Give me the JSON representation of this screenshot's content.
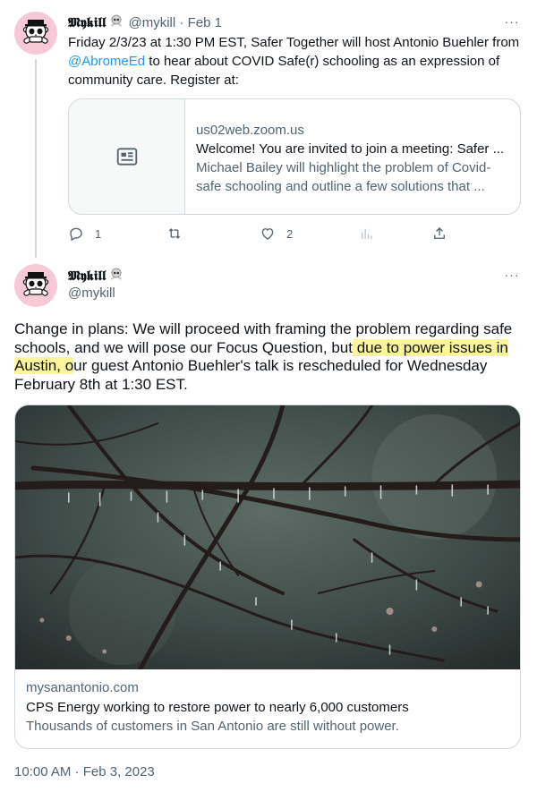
{
  "tweet1": {
    "display_name": "𝕸𝖞𝖐𝖎𝖑𝖑",
    "handle": "@mykill",
    "separator": "·",
    "date": "Feb 1",
    "more": "···",
    "text_part1": "Friday 2/3/23 at 1:30 PM EST, Safer Together will host Antonio Buehler from ",
    "mention": "@AbromeEd",
    "text_part2": " to hear about COVID Safe(r) schooling as an expression of community care. Register at:",
    "card": {
      "domain": "us02web.zoom.us",
      "title": "Welcome! You are invited to join a meeting: Safer ...",
      "description": "Michael Bailey will highlight the problem of Covid-safe schooling and outline a few solutions that ...",
      "icon": "article-icon"
    },
    "actions": {
      "reply_count": "1",
      "retweet_count": "",
      "like_count": "2"
    }
  },
  "tweet2": {
    "display_name": "𝕸𝖞𝖐𝖎𝖑𝖑",
    "handle": "@mykill",
    "more": "···",
    "text_part1": "Change in plans: We will proceed with framing the problem regarding safe schools, and we will pose our Focus Question, but",
    "text_highlight": " due to power issues in Austin, o",
    "text_part2": "ur guest Antonio Buehler's talk is rescheduled for Wednesday February 8th at 1:30 EST.",
    "highlight_color": "#fdf59a",
    "card": {
      "domain": "mysanantonio.com",
      "title": "CPS Energy working to restore power to nearly 6,000 customers",
      "description": "Thousands of customers in San Antonio are still without power."
    },
    "timestamp": "10:00 AM · Feb 3, 2023"
  },
  "colors": {
    "accent": "#1d9bf0",
    "muted": "#536471",
    "border": "#cfd9de",
    "avatar_bg": "#f6c9d6"
  }
}
